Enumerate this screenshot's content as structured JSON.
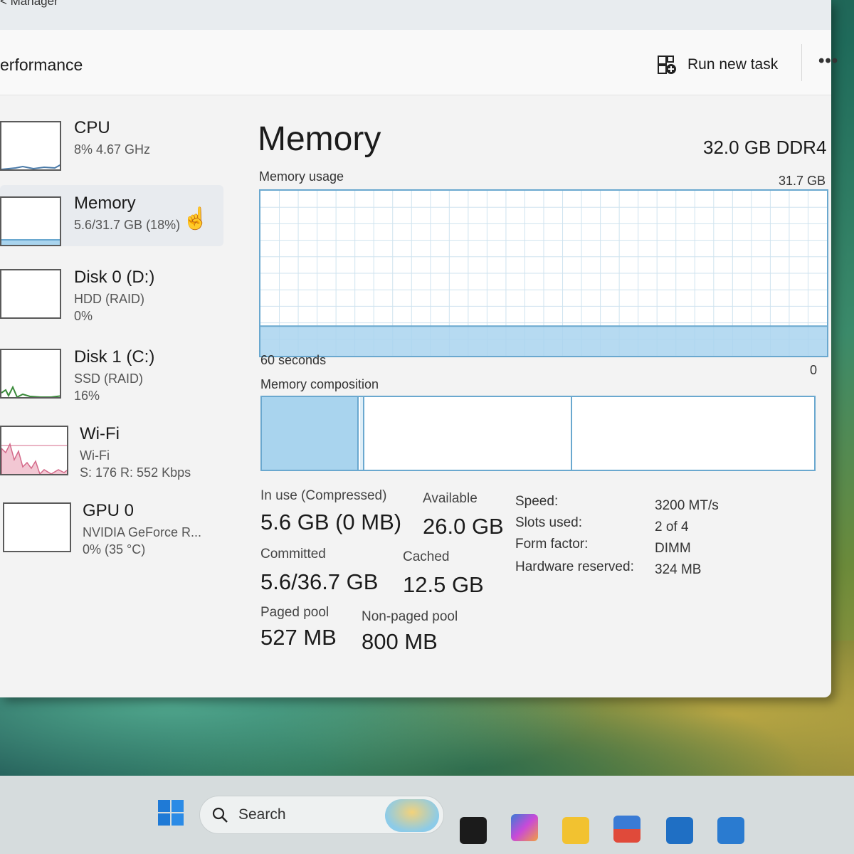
{
  "window": {
    "title": "< Manager",
    "page_title": "erformance",
    "run_task_label": "Run new task",
    "more_label": "•••"
  },
  "sidebar": {
    "items": [
      {
        "name": "CPU",
        "sub1": "8% 4.67 GHz",
        "sub2": ""
      },
      {
        "name": "Memory",
        "sub1": "5.6/31.7 GB (18%)",
        "sub2": ""
      },
      {
        "name": "Disk 0 (D:)",
        "sub1": "HDD (RAID)",
        "sub2": "0%"
      },
      {
        "name": "Disk 1 (C:)",
        "sub1": "SSD (RAID)",
        "sub2": "16%"
      },
      {
        "name": "Wi-Fi",
        "sub1": "Wi-Fi",
        "sub2": "S: 176 R: 552 Kbps"
      },
      {
        "name": "GPU 0",
        "sub1": "NVIDIA GeForce R...",
        "sub2": "0% (35 °C)"
      }
    ]
  },
  "memory": {
    "title": "Memory",
    "spec": "32.0 GB DDR4",
    "usage_label": "Memory usage",
    "usage_max": "31.7 GB",
    "time_label": "60 seconds",
    "zero_label": "0",
    "composition_label": "Memory composition",
    "usage_fraction": 0.18,
    "stats": {
      "in_use_label": "In use (Compressed)",
      "in_use_value": "5.6 GB (0 MB)",
      "available_label": "Available",
      "available_value": "26.0 GB",
      "committed_label": "Committed",
      "committed_value": "5.6/36.7 GB",
      "cached_label": "Cached",
      "cached_value": "12.5 GB",
      "paged_label": "Paged pool",
      "paged_value": "527 MB",
      "nonpaged_label": "Non-paged pool",
      "nonpaged_value": "800 MB"
    },
    "details": [
      {
        "label": "Speed:",
        "value": "3200 MT/s"
      },
      {
        "label": "Slots used:",
        "value": "2 of 4"
      },
      {
        "label": "Form factor:",
        "value": "DIMM"
      },
      {
        "label": "Hardware reserved:",
        "value": "324 MB"
      }
    ]
  },
  "taskbar": {
    "search_placeholder": "Search"
  },
  "colors": {
    "accent": "#6aa8cf",
    "fill": "#a9d4ee",
    "wifi": "#d46a8a"
  }
}
